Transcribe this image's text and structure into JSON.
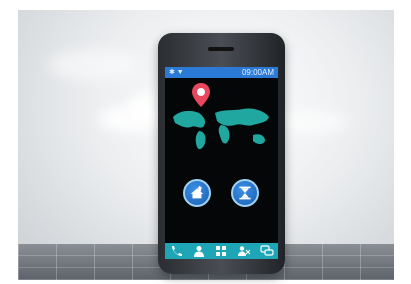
{
  "phone": {
    "status_time": "09:00AM",
    "status_icons": "wifi-signal-icon"
  },
  "colors": {
    "status_bar": "#2b7bd6",
    "map_teal": "#1fa7a0",
    "pin_red": "#e8475d",
    "dock_teal": "#1fa6b6",
    "button_blue": "#2a78cf"
  },
  "icons": [
    "location-pin-icon",
    "world-map-icon",
    "home-upload-icon",
    "hourglass-icon",
    "phone-icon",
    "person-icon",
    "grid-icon",
    "users-icon",
    "chat-icon"
  ]
}
